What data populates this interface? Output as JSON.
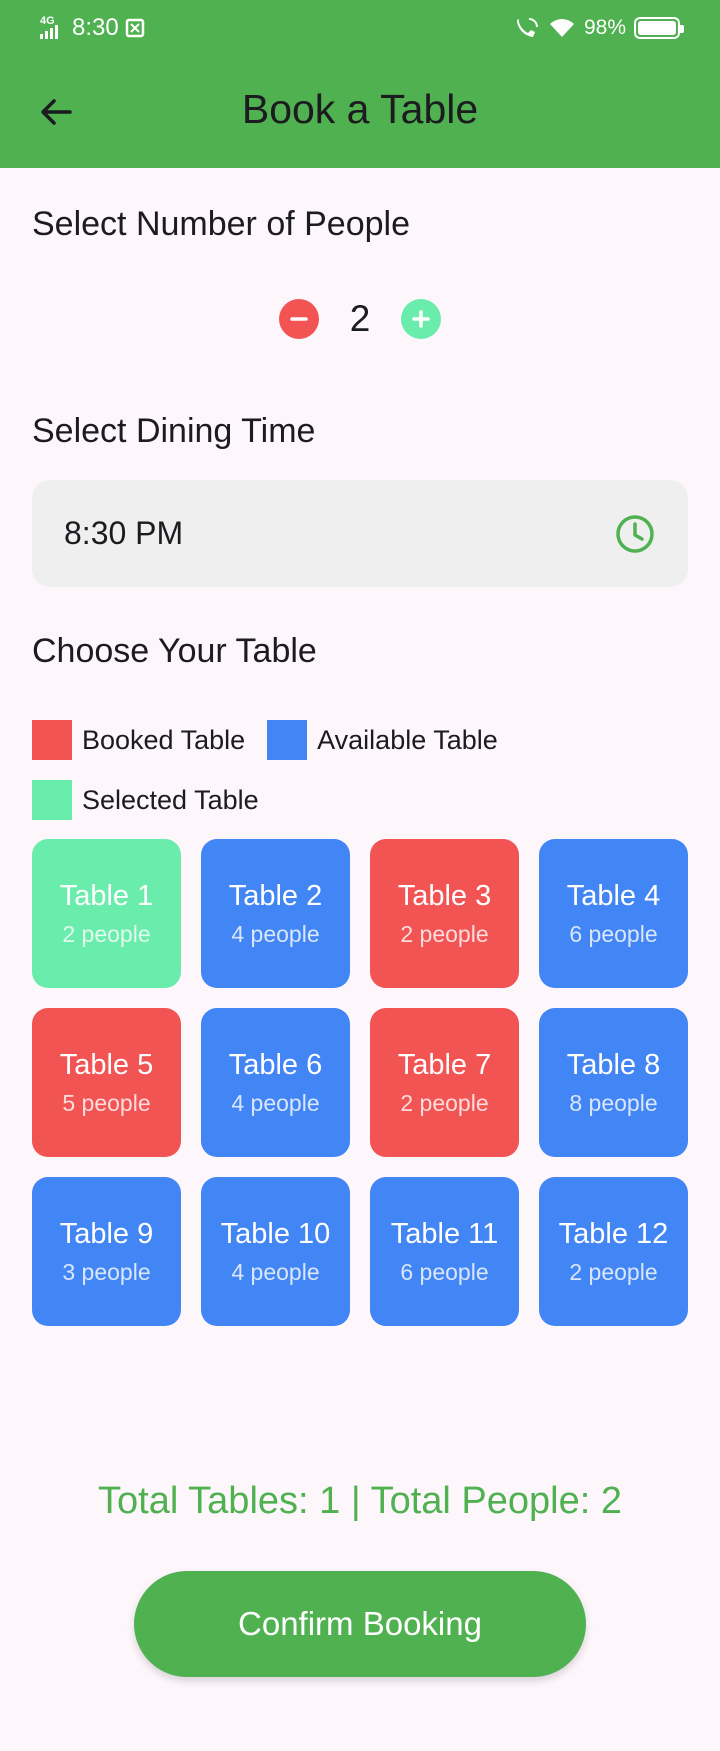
{
  "status_bar": {
    "network": "4G",
    "time": "8:30",
    "battery": "98%"
  },
  "app_bar": {
    "title": "Book a Table"
  },
  "people_section": {
    "title": "Select Number of People",
    "count": "2"
  },
  "time_section": {
    "title": "Select Dining Time",
    "value": "8:30 PM"
  },
  "table_section": {
    "title": "Choose Your Table",
    "legend": [
      {
        "label": "Booked Table",
        "color": "#F25353"
      },
      {
        "label": "Available Table",
        "color": "#4285F4"
      },
      {
        "label": "Selected Table",
        "color": "#6AEDAC"
      }
    ],
    "tables": [
      {
        "name": "Table 1",
        "people": "2 people",
        "status": "selected"
      },
      {
        "name": "Table 2",
        "people": "4 people",
        "status": "available"
      },
      {
        "name": "Table 3",
        "people": "2 people",
        "status": "booked"
      },
      {
        "name": "Table 4",
        "people": "6 people",
        "status": "available"
      },
      {
        "name": "Table 5",
        "people": "5 people",
        "status": "booked"
      },
      {
        "name": "Table 6",
        "people": "4 people",
        "status": "available"
      },
      {
        "name": "Table 7",
        "people": "2 people",
        "status": "booked"
      },
      {
        "name": "Table 8",
        "people": "8 people",
        "status": "available"
      },
      {
        "name": "Table 9",
        "people": "3 people",
        "status": "available"
      },
      {
        "name": "Table 10",
        "people": "4 people",
        "status": "available"
      },
      {
        "name": "Table 11",
        "people": "6 people",
        "status": "available"
      },
      {
        "name": "Table 12",
        "people": "2 people",
        "status": "available"
      }
    ]
  },
  "summary": {
    "text": "Total Tables: 1 | Total People: 2"
  },
  "confirm_button": {
    "label": "Confirm Booking"
  },
  "colors": {
    "primary": "#4FB150",
    "booked": "#F25353",
    "available": "#4285F4",
    "selected": "#6AEDAC"
  }
}
